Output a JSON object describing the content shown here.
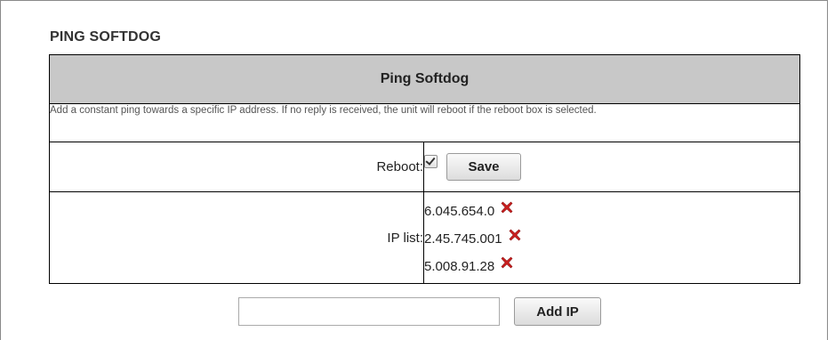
{
  "page": {
    "title": "PING SOFTDOG"
  },
  "table": {
    "header": "Ping Softdog",
    "description": "Add a constant ping towards a specific IP address. If no reply is received, the unit will reboot if the reboot box is selected.",
    "reboot_label": "Reboot:",
    "reboot_checked": true,
    "save_label": "Save",
    "ip_list_label": "IP list:",
    "ip_list": [
      "6.045.654.0",
      "2.45.745.001",
      "5.008.91.28"
    ]
  },
  "add": {
    "input_value": "",
    "button_label": "Add IP"
  },
  "colors": {
    "header_bg": "#c8c8c8",
    "remove_icon": "#cc1f1f"
  },
  "icons": {
    "remove": "close-x-icon",
    "reboot": "checkbox-checked"
  }
}
